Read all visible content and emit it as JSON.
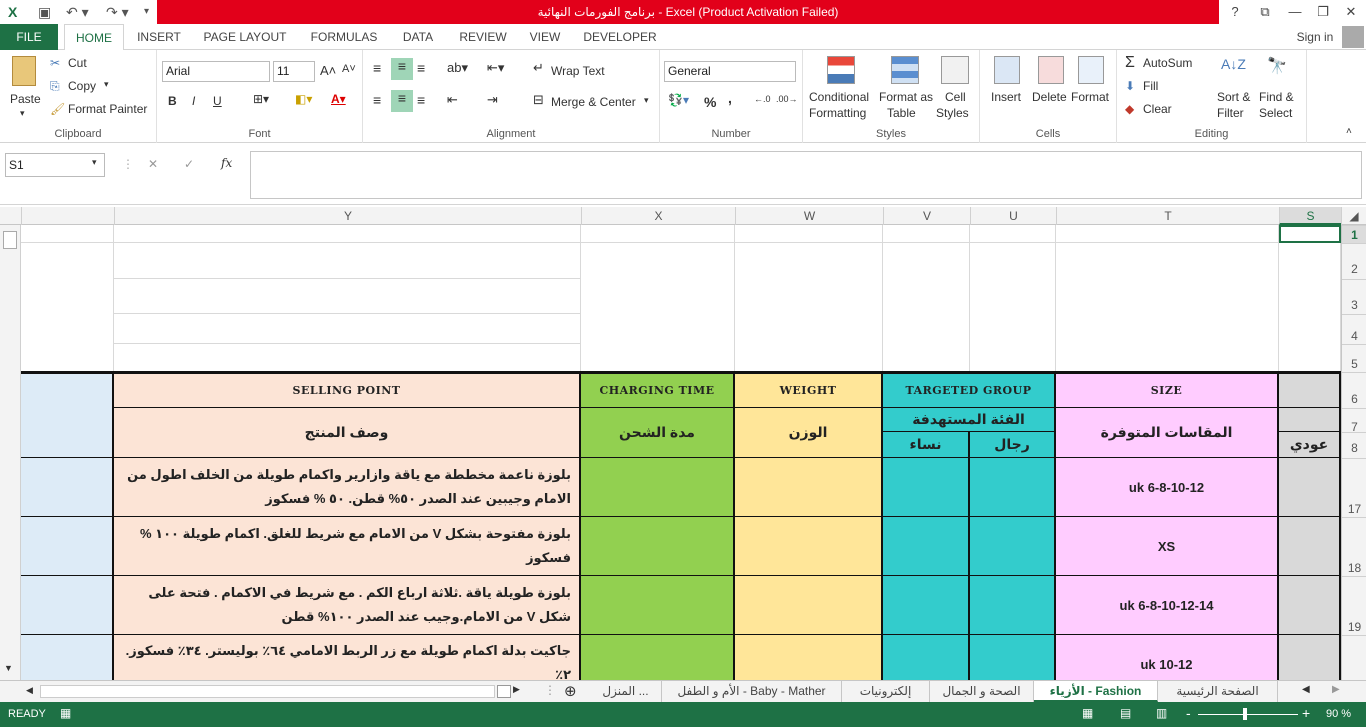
{
  "window": {
    "title": "برنامج الفورمات النهائية  -  Excel (Product Activation Failed)",
    "help": "?",
    "signin": "Sign in"
  },
  "tabs": [
    {
      "label": "FILE"
    },
    {
      "label": "HOME"
    },
    {
      "label": "INSERT"
    },
    {
      "label": "PAGE LAYOUT"
    },
    {
      "label": "FORMULAS"
    },
    {
      "label": "DATA"
    },
    {
      "label": "REVIEW"
    },
    {
      "label": "VIEW"
    },
    {
      "label": "DEVELOPER"
    }
  ],
  "ribbon": {
    "clipboard": {
      "paste": "Paste",
      "cut": "Cut",
      "copy": "Copy",
      "format_painter": "Format Painter",
      "label": "Clipboard"
    },
    "font": {
      "name": "Arial",
      "size": "11",
      "bold": "B",
      "italic": "I",
      "underline": "U",
      "label": "Font"
    },
    "alignment": {
      "wrap": "Wrap Text",
      "merge": "Merge & Center",
      "label": "Alignment"
    },
    "number": {
      "format": "General",
      "percent": "%",
      "comma": ",",
      "label": "Number"
    },
    "styles": {
      "cond": "Conditional",
      "cond2": "Formatting",
      "fat": "Format as",
      "fat2": "Table",
      "cs": "Cell",
      "cs2": "Styles",
      "label": "Styles"
    },
    "cells": {
      "insert": "Insert",
      "delete": "Delete",
      "format": "Format",
      "label": "Cells"
    },
    "editing": {
      "autosum": "AutoSum",
      "fill": "Fill",
      "clear": "Clear",
      "sort": "Sort &",
      "sort2": "Filter",
      "find": "Find &",
      "find2": "Select",
      "label": "Editing"
    }
  },
  "formula_bar": {
    "namebox": "S1",
    "fx": "fx",
    "cancel": "✕",
    "enter": "✓",
    "value": ""
  },
  "columns": [
    "Y",
    "X",
    "W",
    "V",
    "U",
    "T",
    "S"
  ],
  "rows": [
    "1",
    "2",
    "3",
    "4",
    "5",
    "6",
    "7",
    "8",
    "17",
    "18",
    "19"
  ],
  "headers": {
    "selling_point": "SELLING POINT",
    "charging_time": "CHARGING TIME",
    "weight": "WEIGHT",
    "targeted_group": "TARGETED GROUP",
    "size": "SIZE",
    "desc_ar": "وصف المنتج",
    "charging_ar": "مدة الشحن",
    "weight_ar": "الوزن",
    "group_ar": "الفئة المستهدفة",
    "women": "نساء",
    "men": "رجال",
    "sizes_ar": "المقاسات المتوفرة",
    "s8": "عودي"
  },
  "products": [
    {
      "desc": "بلوزة ناعمة مخططة مع ياقة وازارير واكمام طويلة  من الخلف اطول من الامام وجيبين عند الصدر  ٥٠% قطن. ٥٠ % فسكوز",
      "size": "uk 6-8-10-12"
    },
    {
      "desc": "بلوزة مفتوحة بشكل V من الامام مع شريط للغلق. اكمام طويلة ١٠٠ % فسكوز",
      "size": "XS"
    },
    {
      "desc": "بلوزة طويلة ياقة .ثلاثة ارباع الكم . مع شريط في الاكمام . فتحة على شكل V من الامام.وجيب عند الصدر ١٠٠% قطن",
      "size": "uk 6-8-10-12-14"
    },
    {
      "desc": "جاكيت بدلة اكمام طويلة مع زر الربط الامامي ٦٤٪ بوليستر. ٣٤٪ فسكوز. ٢٪ ",
      "size": "uk 10-12"
    }
  ],
  "sheet_tabs": [
    "الصفحة الرئيسية",
    "الأزياء - Fashion",
    "الصحة و الجمال",
    "إلكترونيات",
    "الأم و الطفل - Baby - Mather",
    "المنزل ..."
  ],
  "status": {
    "ready": "READY",
    "zoom": "90 %",
    "minus": "-",
    "plus": "+"
  },
  "colors": {
    "excel_green": "#1e7145",
    "title_red": "#e2001a",
    "peach": "#fce4d6",
    "green": "#92d050",
    "yellow": "#ffe699",
    "teal": "#33cccc",
    "pink": "#ffccff",
    "gray": "#d9d9d9",
    "lightblue": "#ddebf7"
  }
}
